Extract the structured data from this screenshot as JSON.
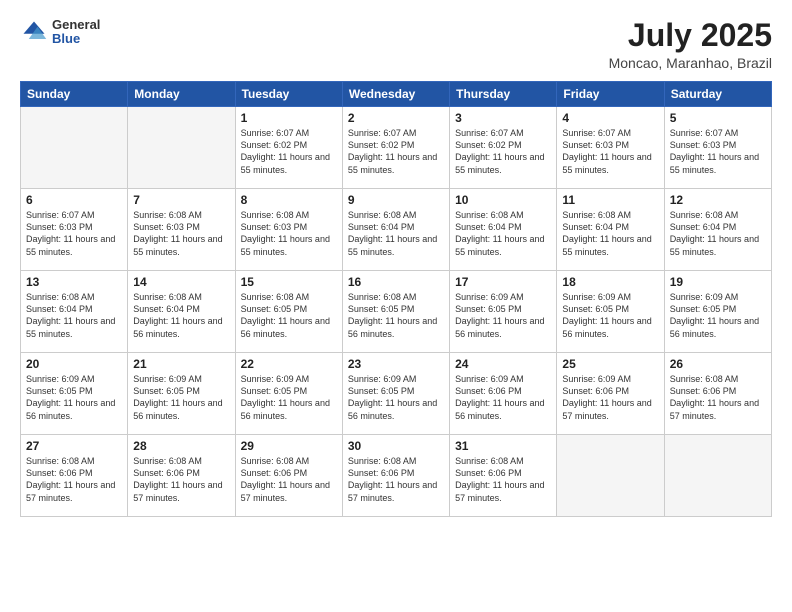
{
  "header": {
    "logo": {
      "general": "General",
      "blue": "Blue"
    },
    "title": "July 2025",
    "subtitle": "Moncao, Maranhao, Brazil"
  },
  "weekdays": [
    "Sunday",
    "Monday",
    "Tuesday",
    "Wednesday",
    "Thursday",
    "Friday",
    "Saturday"
  ],
  "weeks": [
    [
      {
        "day": "",
        "empty": true
      },
      {
        "day": "",
        "empty": true
      },
      {
        "day": "1",
        "sunrise": "6:07 AM",
        "sunset": "6:02 PM",
        "daylight": "11 hours and 55 minutes."
      },
      {
        "day": "2",
        "sunrise": "6:07 AM",
        "sunset": "6:02 PM",
        "daylight": "11 hours and 55 minutes."
      },
      {
        "day": "3",
        "sunrise": "6:07 AM",
        "sunset": "6:02 PM",
        "daylight": "11 hours and 55 minutes."
      },
      {
        "day": "4",
        "sunrise": "6:07 AM",
        "sunset": "6:03 PM",
        "daylight": "11 hours and 55 minutes."
      },
      {
        "day": "5",
        "sunrise": "6:07 AM",
        "sunset": "6:03 PM",
        "daylight": "11 hours and 55 minutes."
      }
    ],
    [
      {
        "day": "6",
        "sunrise": "6:07 AM",
        "sunset": "6:03 PM",
        "daylight": "11 hours and 55 minutes."
      },
      {
        "day": "7",
        "sunrise": "6:08 AM",
        "sunset": "6:03 PM",
        "daylight": "11 hours and 55 minutes."
      },
      {
        "day": "8",
        "sunrise": "6:08 AM",
        "sunset": "6:03 PM",
        "daylight": "11 hours and 55 minutes."
      },
      {
        "day": "9",
        "sunrise": "6:08 AM",
        "sunset": "6:04 PM",
        "daylight": "11 hours and 55 minutes."
      },
      {
        "day": "10",
        "sunrise": "6:08 AM",
        "sunset": "6:04 PM",
        "daylight": "11 hours and 55 minutes."
      },
      {
        "day": "11",
        "sunrise": "6:08 AM",
        "sunset": "6:04 PM",
        "daylight": "11 hours and 55 minutes."
      },
      {
        "day": "12",
        "sunrise": "6:08 AM",
        "sunset": "6:04 PM",
        "daylight": "11 hours and 55 minutes."
      }
    ],
    [
      {
        "day": "13",
        "sunrise": "6:08 AM",
        "sunset": "6:04 PM",
        "daylight": "11 hours and 55 minutes."
      },
      {
        "day": "14",
        "sunrise": "6:08 AM",
        "sunset": "6:04 PM",
        "daylight": "11 hours and 56 minutes."
      },
      {
        "day": "15",
        "sunrise": "6:08 AM",
        "sunset": "6:05 PM",
        "daylight": "11 hours and 56 minutes."
      },
      {
        "day": "16",
        "sunrise": "6:08 AM",
        "sunset": "6:05 PM",
        "daylight": "11 hours and 56 minutes."
      },
      {
        "day": "17",
        "sunrise": "6:09 AM",
        "sunset": "6:05 PM",
        "daylight": "11 hours and 56 minutes."
      },
      {
        "day": "18",
        "sunrise": "6:09 AM",
        "sunset": "6:05 PM",
        "daylight": "11 hours and 56 minutes."
      },
      {
        "day": "19",
        "sunrise": "6:09 AM",
        "sunset": "6:05 PM",
        "daylight": "11 hours and 56 minutes."
      }
    ],
    [
      {
        "day": "20",
        "sunrise": "6:09 AM",
        "sunset": "6:05 PM",
        "daylight": "11 hours and 56 minutes."
      },
      {
        "day": "21",
        "sunrise": "6:09 AM",
        "sunset": "6:05 PM",
        "daylight": "11 hours and 56 minutes."
      },
      {
        "day": "22",
        "sunrise": "6:09 AM",
        "sunset": "6:05 PM",
        "daylight": "11 hours and 56 minutes."
      },
      {
        "day": "23",
        "sunrise": "6:09 AM",
        "sunset": "6:05 PM",
        "daylight": "11 hours and 56 minutes."
      },
      {
        "day": "24",
        "sunrise": "6:09 AM",
        "sunset": "6:06 PM",
        "daylight": "11 hours and 56 minutes."
      },
      {
        "day": "25",
        "sunrise": "6:09 AM",
        "sunset": "6:06 PM",
        "daylight": "11 hours and 57 minutes."
      },
      {
        "day": "26",
        "sunrise": "6:08 AM",
        "sunset": "6:06 PM",
        "daylight": "11 hours and 57 minutes."
      }
    ],
    [
      {
        "day": "27",
        "sunrise": "6:08 AM",
        "sunset": "6:06 PM",
        "daylight": "11 hours and 57 minutes."
      },
      {
        "day": "28",
        "sunrise": "6:08 AM",
        "sunset": "6:06 PM",
        "daylight": "11 hours and 57 minutes."
      },
      {
        "day": "29",
        "sunrise": "6:08 AM",
        "sunset": "6:06 PM",
        "daylight": "11 hours and 57 minutes."
      },
      {
        "day": "30",
        "sunrise": "6:08 AM",
        "sunset": "6:06 PM",
        "daylight": "11 hours and 57 minutes."
      },
      {
        "day": "31",
        "sunrise": "6:08 AM",
        "sunset": "6:06 PM",
        "daylight": "11 hours and 57 minutes."
      },
      {
        "day": "",
        "empty": true
      },
      {
        "day": "",
        "empty": true
      }
    ]
  ]
}
